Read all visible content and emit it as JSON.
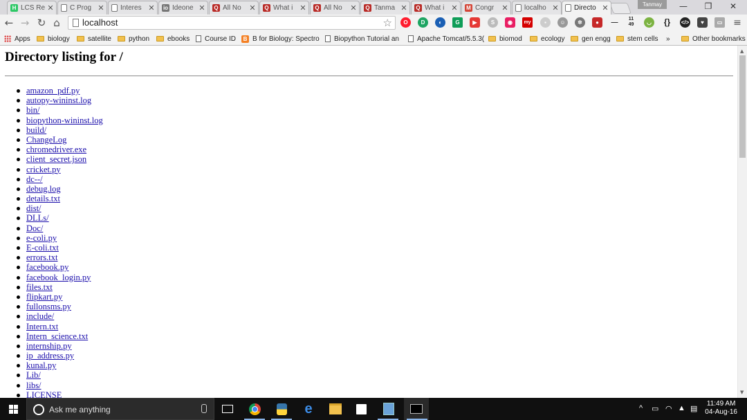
{
  "browser": {
    "tabs": [
      {
        "title": "LCS Re",
        "favicon": "hackerrank-icon",
        "color": "#2ec866",
        "letter": "H"
      },
      {
        "title": "C Prog",
        "favicon": "page-icon",
        "color": "#ffffff",
        "letter": ""
      },
      {
        "title": "Interes",
        "favicon": "page-icon",
        "color": "#ffffff",
        "letter": ""
      },
      {
        "title": "Ideone",
        "favicon": "ideone-icon",
        "color": "#777777",
        "letter": "io"
      },
      {
        "title": "All No",
        "favicon": "quora-icon",
        "color": "#b92b27",
        "letter": "Q"
      },
      {
        "title": "What i",
        "favicon": "quora-icon",
        "color": "#b92b27",
        "letter": "Q"
      },
      {
        "title": "All No",
        "favicon": "quora-icon",
        "color": "#b92b27",
        "letter": "Q"
      },
      {
        "title": "Tanma",
        "favicon": "quora-icon",
        "color": "#b92b27",
        "letter": "Q"
      },
      {
        "title": "What i",
        "favicon": "quora-icon",
        "color": "#b92b27",
        "letter": "Q"
      },
      {
        "title": "Congr",
        "favicon": "gmail-icon",
        "color": "#d44638",
        "letter": "M"
      },
      {
        "title": "localho",
        "favicon": "page-icon",
        "color": "#ffffff",
        "letter": ""
      },
      {
        "title": "Directo",
        "favicon": "page-icon",
        "color": "#ffffff",
        "letter": "",
        "active": true
      }
    ],
    "profile_name": "Tanmay",
    "address": "localhost",
    "window_controls": {
      "minimize": "—",
      "restore": "❐",
      "close": "✕"
    }
  },
  "bookmarks": [
    {
      "label": "Apps",
      "kind": "apps"
    },
    {
      "label": "biology",
      "kind": "folder"
    },
    {
      "label": "satellite",
      "kind": "folder"
    },
    {
      "label": "python",
      "kind": "folder"
    },
    {
      "label": "ebooks",
      "kind": "folder"
    },
    {
      "label": "Course ID",
      "kind": "page"
    },
    {
      "label": "B for Biology: Spectro",
      "kind": "b"
    },
    {
      "label": "Biopython Tutorial an",
      "kind": "page"
    },
    {
      "label": "Apache Tomcat/5.5.3(",
      "kind": "page"
    },
    {
      "label": "biomod",
      "kind": "folder"
    },
    {
      "label": "ecology",
      "kind": "folder"
    },
    {
      "label": "gen engg",
      "kind": "folder"
    },
    {
      "label": "stem cells",
      "kind": "folder"
    },
    {
      "label": "»",
      "kind": "more"
    },
    {
      "label": "Other bookmarks",
      "kind": "folder"
    }
  ],
  "extension_badge": "11\n49",
  "page": {
    "heading": "Directory listing for /",
    "files": [
      "amazon_pdf.py",
      "autopy-wininst.log",
      "bin/",
      "biopython-wininst.log",
      "build/",
      "ChangeLog",
      "chromedriver.exe",
      "client_secret.json",
      "cricket.py",
      "dc--/",
      "debug.log",
      "details.txt",
      "dist/",
      "DLLs/",
      "Doc/",
      "e-coli.py",
      "E-coli.txt",
      "errors.txt",
      "facebook.py",
      "facebook_login.py",
      "files.txt",
      "flipkart.py",
      "fullonsms.py",
      "include/",
      "Intern.txt",
      "Intern_science.txt",
      "internship.py",
      "ip_address.py",
      "kunal.py",
      "Lib/",
      "libs/",
      "LICENSE"
    ]
  },
  "taskbar": {
    "search_placeholder": "Ask me anything",
    "time": "11:49 AM",
    "date": "04-Aug-16"
  }
}
